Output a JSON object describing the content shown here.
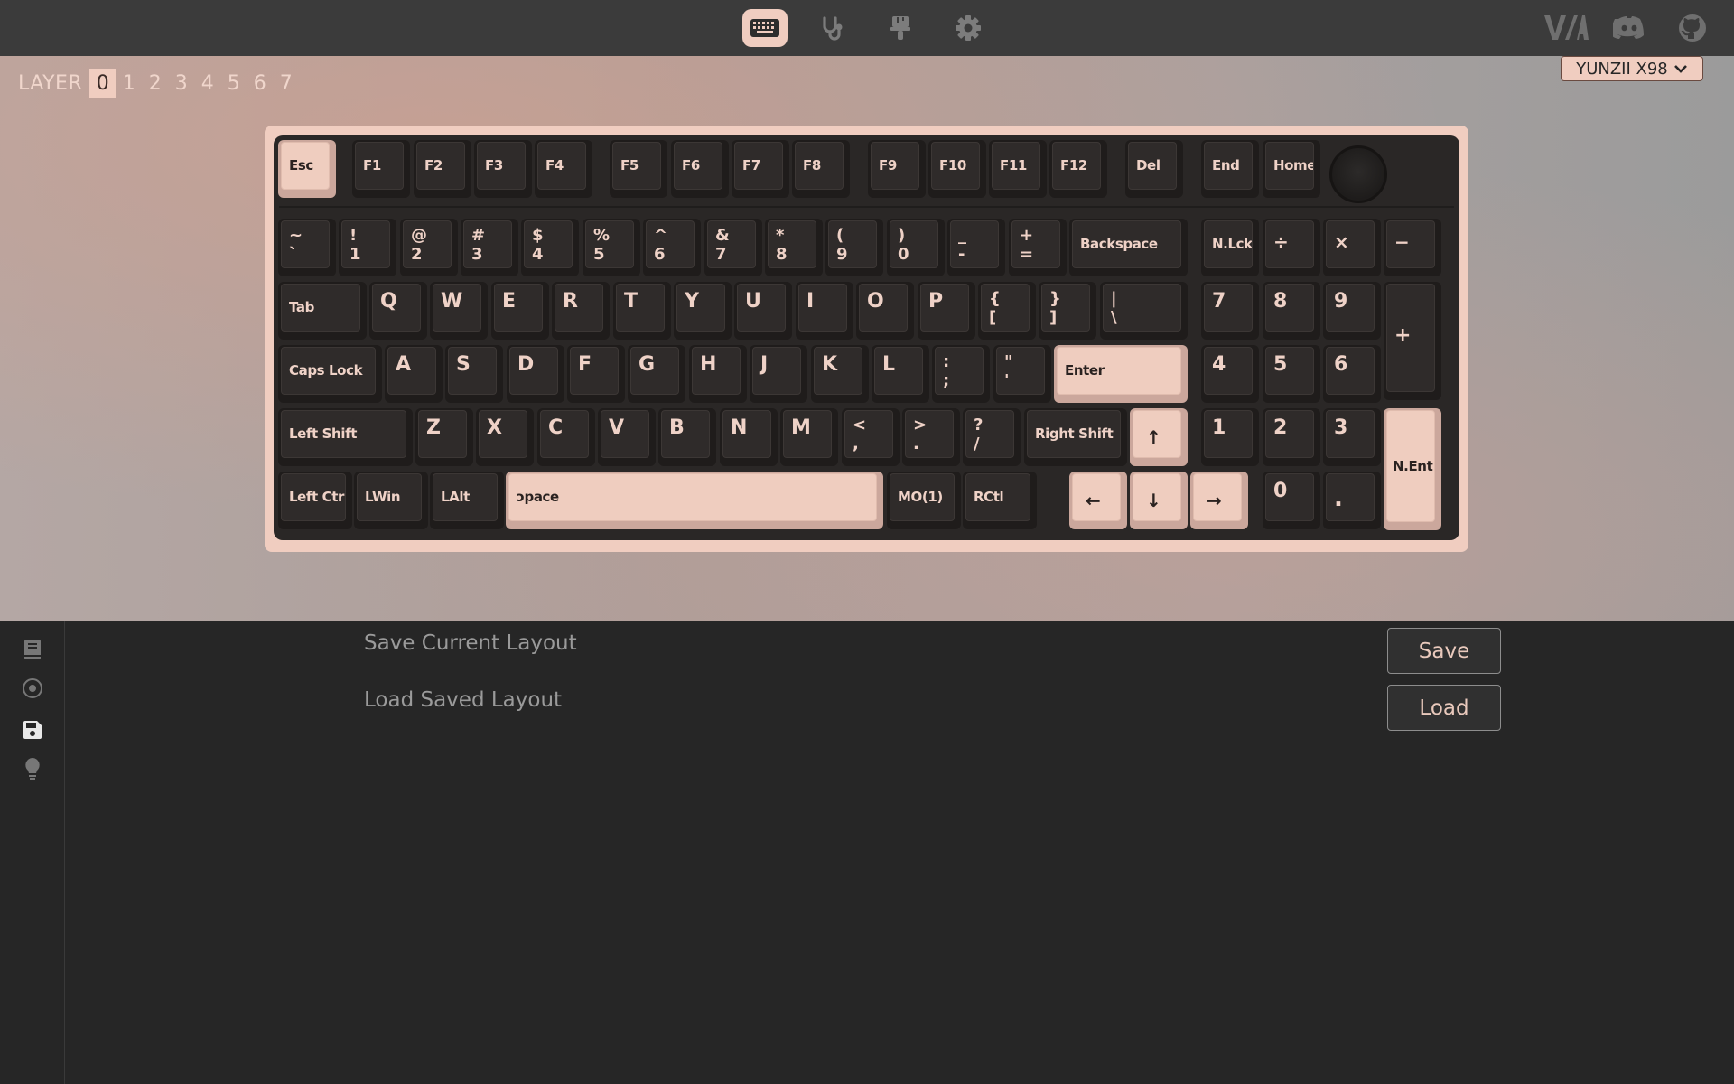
{
  "topbar": {
    "tabs": [
      {
        "name": "configure",
        "icon": "keyboard-icon",
        "active": true
      },
      {
        "name": "test",
        "icon": "stethoscope-icon",
        "active": false
      },
      {
        "name": "design",
        "icon": "paintbrush-icon",
        "active": false
      },
      {
        "name": "settings",
        "icon": "gear-icon",
        "active": false
      }
    ],
    "logo_text": "V/A",
    "right_icons": [
      "discord-icon",
      "github-icon"
    ]
  },
  "layers": {
    "label": "LAYER",
    "items": [
      "0",
      "1",
      "2",
      "3",
      "4",
      "5",
      "6",
      "7"
    ],
    "selected": "0"
  },
  "device": {
    "name": "YUNZII X98"
  },
  "keyboard": {
    "keys": {
      "esc": "Esc",
      "f1": "F1",
      "f2": "F2",
      "f3": "F3",
      "f4": "F4",
      "f5": "F5",
      "f6": "F6",
      "f7": "F7",
      "f8": "F8",
      "f9": "F9",
      "f10": "F10",
      "f11": "F11",
      "f12": "F12",
      "del": "Del",
      "end": "End",
      "home": "Home",
      "grave_top": "~",
      "grave_bot": "`",
      "n1_top": "!",
      "n1_bot": "1",
      "n2_top": "@",
      "n2_bot": "2",
      "n3_top": "#",
      "n3_bot": "3",
      "n4_top": "$",
      "n4_bot": "4",
      "n5_top": "%",
      "n5_bot": "5",
      "n6_top": "^",
      "n6_bot": "6",
      "n7_top": "&",
      "n7_bot": "7",
      "n8_top": "*",
      "n8_bot": "8",
      "n9_top": "(",
      "n9_bot": "9",
      "n0_top": ")",
      "n0_bot": "0",
      "minus_top": "_",
      "minus_bot": "-",
      "equal_top": "+",
      "equal_bot": "=",
      "backspace": "Backspace",
      "numlock": "N.Lck",
      "kp_div": "÷",
      "kp_mul": "×",
      "kp_minus": "−",
      "tab": "Tab",
      "q": "Q",
      "w": "W",
      "e": "E",
      "r": "R",
      "t": "T",
      "y": "Y",
      "u": "U",
      "i": "I",
      "o": "O",
      "p": "P",
      "lbracket_top": "{",
      "lbracket_bot": "[",
      "rbracket_top": "}",
      "rbracket_bot": "]",
      "bslash_top": "|",
      "bslash_bot": "\\",
      "kp7": "7",
      "kp8": "8",
      "kp9": "9",
      "kp_plus": "+",
      "caps": "Caps Lock",
      "a": "A",
      "s": "S",
      "d": "D",
      "f": "F",
      "g": "G",
      "h": "H",
      "j": "J",
      "k": "K",
      "l": "L",
      "semi_top": ":",
      "semi_bot": ";",
      "quote_top": "\"",
      "quote_bot": "'",
      "enter": "Enter",
      "kp4": "4",
      "kp5": "5",
      "kp6": "6",
      "lshift": "Left Shift",
      "z": "Z",
      "x": "X",
      "c": "C",
      "v": "V",
      "b": "B",
      "n": "N",
      "m": "M",
      "comma_top": "<",
      "comma_bot": ",",
      "dot_top": ">",
      "dot_bot": ".",
      "slash_top": "?",
      "slash_bot": "/",
      "rshift": "Right Shift",
      "up": "↑",
      "kp1": "1",
      "kp2": "2",
      "kp3": "3",
      "kp_enter": "N.Ent",
      "lctrl": "Left Ctrl",
      "lwin": "LWin",
      "lalt": "LAlt",
      "space": "ɔpace",
      "mo1": "MO(1)",
      "rctl": "RCtl",
      "left": "←",
      "down": "↓",
      "right": "→",
      "kp0": "0",
      "kp_dot": "."
    }
  },
  "sidebar": {
    "items": [
      {
        "name": "macros",
        "icon": "book-icon"
      },
      {
        "name": "lighting",
        "icon": "target-icon"
      },
      {
        "name": "save-load",
        "icon": "save-icon",
        "active": true
      },
      {
        "name": "qmk",
        "icon": "lightbulb-icon"
      }
    ]
  },
  "panel": {
    "save_label": "Save Current Layout",
    "save_button": "Save",
    "load_label": "Load Saved Layout",
    "load_button": "Load"
  },
  "colors": {
    "accent": "#f0cdc0",
    "topbar": "#3b3b3b",
    "background": "#262626"
  }
}
